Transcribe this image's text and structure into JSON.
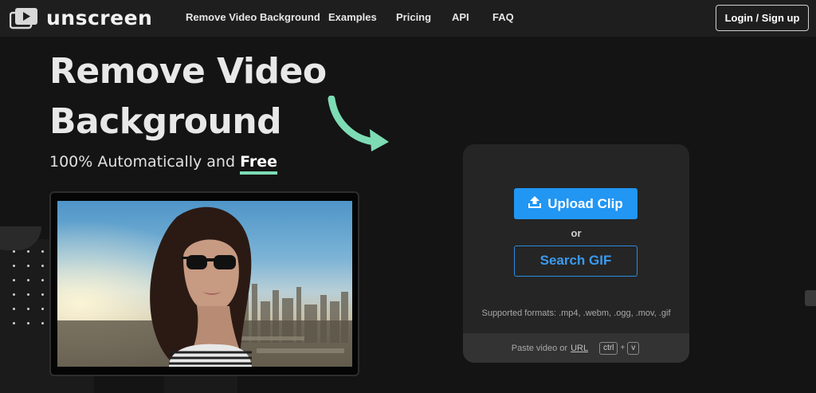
{
  "brand": {
    "name": "unscreen",
    "logo_icon": "play-stack-icon"
  },
  "nav": {
    "links": [
      {
        "label": "Remove Video Background"
      },
      {
        "label": "Examples"
      },
      {
        "label": "Pricing"
      },
      {
        "label": "API"
      },
      {
        "label": "FAQ"
      }
    ],
    "login_label": "Login / Sign up"
  },
  "hero": {
    "title": "Remove Video Background",
    "subtitle_prefix": "100% Automatically and ",
    "subtitle_highlight": "Free",
    "arrow_icon": "curved-arrow-icon",
    "arrow_color": "#7ddcb4"
  },
  "upload": {
    "upload_label": "Upload Clip",
    "upload_icon": "upload-icon",
    "or_label": "or",
    "search_label": "Search GIF",
    "formats_label": "Supported formats: .mp4, .webm, .ogg, .mov, .gif",
    "paste_prefix": "Paste video or",
    "paste_link": "URL",
    "key_ctrl": "ctrl",
    "key_plus": "+",
    "key_v": "v",
    "accent_color": "#2196f3"
  }
}
